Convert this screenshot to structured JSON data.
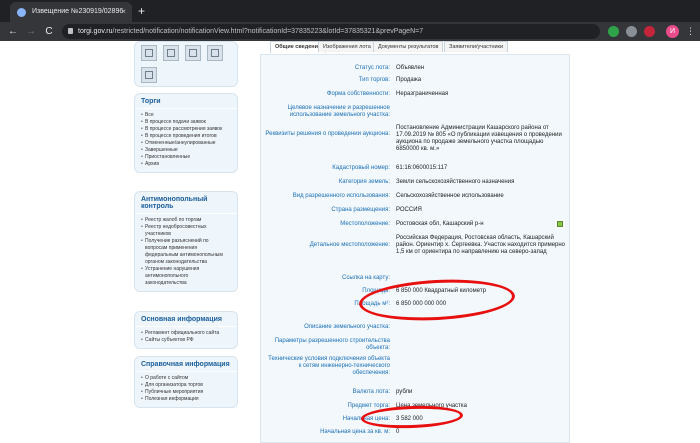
{
  "browser": {
    "tab_title": "Извещение №230919/02896",
    "tab_close": "×",
    "newtab": "+",
    "back": "←",
    "forward": "→",
    "reload": "C",
    "url_host": "torgi.gov.ru",
    "url_path": "/restricted/notification/notificationView.html?notificationId=37835223&lotId=37835321&prevPageN=7",
    "avatar_letter": "И",
    "menu": "⋮"
  },
  "sidebar": {
    "torgi_title": "Торги",
    "torgi_items": [
      "Все",
      "В процессе подачи заявок",
      "В процессе рассмотрения заявок",
      "В процессе проведения итогов",
      "Отмененные/аннулированные",
      "Завершенные",
      "Приостановленные",
      "Архив"
    ],
    "anti_title": "Антимонопольный контроль",
    "anti_items": [
      "Реестр жалоб по торгам",
      "Реестр недобросовестных участников",
      "Получение разъяснений по вопросам применения федеральным антимонопольным органом законодательства",
      "Устранение нарушения антимонопольного законодательства"
    ],
    "main_title": "Основная информация",
    "main_items": [
      "Регламент официального сайта",
      "Сайты субъектов РФ"
    ],
    "ref_title": "Справочная информация",
    "ref_items": [
      "О работе с сайтом",
      "Для организатора торгов",
      "Публичные мероприятия",
      "Полезная информация"
    ]
  },
  "tabs": [
    "Общие сведения",
    "Изображения лота",
    "Документы результатов",
    "Заявители/участники"
  ],
  "fields": [
    {
      "label": "Статус лота:",
      "value": "Объявлен"
    },
    {
      "label": "Тип торгов:",
      "value": "Продажа"
    },
    {
      "label": "Форма собственности:",
      "value": "Неразграниченная"
    },
    {
      "label": "Целевое назначение и разрешенное использование земельного участка:",
      "value": ""
    },
    {
      "label": "Реквизиты решения о проведении аукциона:",
      "value": "Постановление Администрации Кашарского района от 17.09.2019 № 805 «О публикации извещения о проведении аукциона по продаже земельного участка площадью 6850000 кв. м.»"
    },
    {
      "label": "Кадастровый номер:",
      "value": "61:16:0600015:117"
    },
    {
      "label": "Категория земель:",
      "value": "Земли сельскохозяйственного назначения"
    },
    {
      "label": "Вид разрешенного использования:",
      "value": "Сельскохозяйственное использование"
    },
    {
      "label": "Страна размещения:",
      "value": "РОССИЯ"
    },
    {
      "label": "Местоположение:",
      "value": "Ростовская обл, Кашарский р-н"
    },
    {
      "label": "Детальное местоположение:",
      "value": "Российская Федерация, Ростовская область, Кашарский район. Ориентир х. Сергеевка. Участок находится примерно 1,5 км от ориентира по направлению на северо-запад"
    },
    {
      "label": "Ссылка на карту:",
      "value": ""
    },
    {
      "label": "Площадь:",
      "value": "6 850 000 Квадратный километр"
    },
    {
      "label": "Площадь м²:",
      "value": "6 850 000 000 000"
    },
    {
      "label": "Описание земельного участка:",
      "value": ""
    },
    {
      "label": "Параметры разрешенного строительства объекта:",
      "value": ""
    },
    {
      "label": "Технические условия подключения объекта к сетям инженерно-технического обеспечения:",
      "value": ""
    },
    {
      "label": "Валюта лота:",
      "value": "рубли"
    },
    {
      "label": "Предмет торга:",
      "value": "Цена земельного участка"
    },
    {
      "label": "Начальная цена:",
      "value": "3 582 000"
    },
    {
      "label": "Начальная цена за кв. м:",
      "value": "0"
    }
  ]
}
